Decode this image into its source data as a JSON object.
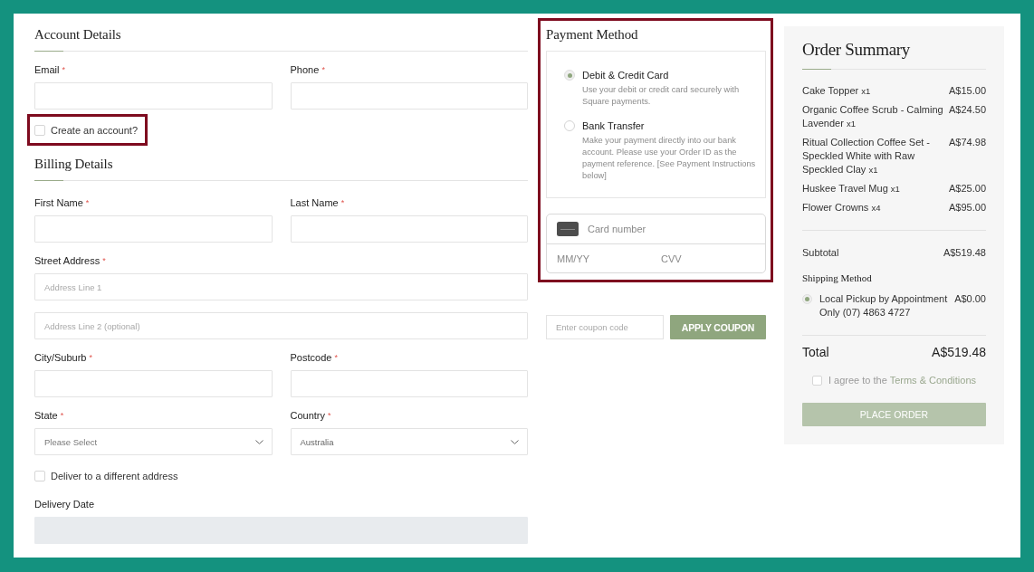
{
  "account": {
    "title": "Account Details",
    "fields": [
      {
        "kind": "text",
        "label": "Email",
        "required_mark": "*"
      },
      {
        "kind": "text",
        "label": "Phone",
        "required_mark": "*"
      }
    ],
    "create_account": {
      "label": "Create an account?",
      "checked": false,
      "highlighted": true
    }
  },
  "billing": {
    "title": "Billing Details",
    "rows": [
      [
        {
          "kind": "text",
          "label": "First Name",
          "required_mark": "*"
        },
        {
          "kind": "text",
          "label": "Last Name",
          "required_mark": "*"
        }
      ],
      [
        {
          "kind": "address",
          "label": "Street Address",
          "required_mark": "*",
          "lines": [
            {
              "placeholder": "Address Line 1"
            },
            {
              "placeholder": "Address Line 2 (optional)"
            }
          ]
        }
      ],
      [
        {
          "kind": "text",
          "label": "City/Suburb",
          "required_mark": "*"
        },
        {
          "kind": "text",
          "label": "Postcode",
          "required_mark": "*"
        }
      ],
      [
        {
          "kind": "select",
          "label": "State",
          "required_mark": "*",
          "placeholder": "Please Select"
        },
        {
          "kind": "select",
          "label": "Country",
          "required_mark": "*",
          "value": "Australia"
        }
      ]
    ],
    "deliver_to_different_address": {
      "label": "Deliver to a different address",
      "checked": false
    },
    "delivery_date": {
      "label": "Delivery Date",
      "disabled": true
    }
  },
  "payment": {
    "title": "Payment Method",
    "highlighted": true,
    "methods": [
      {
        "label": "Debit & Credit Card",
        "description": "Use your debit or credit card securely with Square payments.",
        "selected": true
      },
      {
        "label": "Bank Transfer",
        "description": "Make your payment directly into our bank account. Please use your Order ID as the payment reference. [See Payment Instructions below]",
        "selected": false
      }
    ],
    "card_form": {
      "card_number_placeholder": "Card number",
      "expiry_placeholder": "MM/YY",
      "cvv_placeholder": "CVV"
    }
  },
  "coupon": {
    "placeholder": "Enter coupon code",
    "button": "APPLY COUPON"
  },
  "order_summary": {
    "title": "Order Summary",
    "items": [
      {
        "name": "Cake Topper",
        "quantity": "x1",
        "price": "A$15.00"
      },
      {
        "name": "Organic Coffee Scrub - Calming Lavender",
        "quantity": "x1",
        "price": "A$24.50"
      },
      {
        "name": "Ritual Collection Coffee Set - Speckled White with Raw Speckled Clay",
        "quantity": "x1",
        "price": "A$74.98"
      },
      {
        "name": "Huskee Travel Mug",
        "quantity": "x1",
        "price": "A$25.00"
      },
      {
        "name": "Flower Crowns",
        "quantity": "x4",
        "price": "A$95.00"
      }
    ],
    "subtotal": {
      "label": "Subtotal",
      "value": "A$519.48"
    },
    "shipping": {
      "title": "Shipping Method",
      "options": [
        {
          "label": "Local Pickup by Appointment Only (07) 4863 4727",
          "price": "A$0.00",
          "selected": true
        }
      ]
    },
    "total": {
      "label": "Total",
      "value": "A$519.48"
    },
    "terms": {
      "text": "I agree to the",
      "link": "Terms & Conditions",
      "checked": false
    },
    "place_order": {
      "label": "PLACE ORDER",
      "disabled": true
    }
  }
}
